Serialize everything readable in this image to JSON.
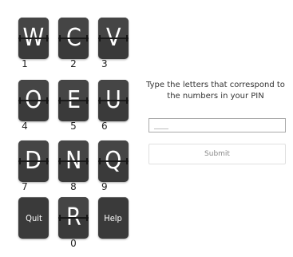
{
  "keypad": {
    "keys": [
      {
        "letter": "W",
        "number": "1"
      },
      {
        "letter": "C",
        "number": "2"
      },
      {
        "letter": "V",
        "number": "3"
      },
      {
        "letter": "O",
        "number": "4"
      },
      {
        "letter": "E",
        "number": "5"
      },
      {
        "letter": "U",
        "number": "6"
      },
      {
        "letter": "D",
        "number": "7"
      },
      {
        "letter": "N",
        "number": "8"
      },
      {
        "letter": "Q",
        "number": "9"
      },
      {
        "letter": "R",
        "number": "0"
      }
    ],
    "quit_label": "Quit",
    "help_label": "Help"
  },
  "pin_form": {
    "instructions": "Type the letters that correspond to the numbers in your PIN",
    "input_value": "___",
    "submit_label": "Submit"
  },
  "colors": {
    "tile_background": "#3a3a3a",
    "tile_text": "#ffffff",
    "page_background": "#ffffff"
  }
}
